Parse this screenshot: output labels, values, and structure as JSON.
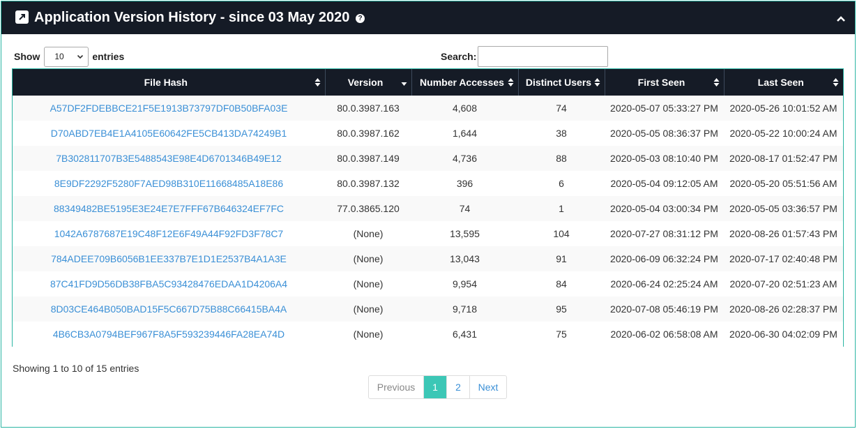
{
  "header": {
    "title": "Application Version History - since 03 May 2020",
    "help": "?"
  },
  "controls": {
    "show_label": "Show",
    "length_value": "10",
    "entries_label": "entries",
    "search_label": "Search:",
    "search_value": ""
  },
  "table": {
    "columns": [
      "File Hash",
      "Version",
      "Number Accesses",
      "Distinct Users",
      "First Seen",
      "Last Seen"
    ],
    "sorted_column": "Version",
    "sort_direction": "desc",
    "rows": [
      [
        "A57DF2FDEBBCE21F5E1913B73797DF0B50BFA03E",
        "80.0.3987.163",
        "4,608",
        "74",
        "2020-05-07 05:33:27 PM",
        "2020-05-26 10:01:52 AM"
      ],
      [
        "D70ABD7EB4E1A4105E60642FE5CB413DA74249B1",
        "80.0.3987.162",
        "1,644",
        "38",
        "2020-05-05 08:36:37 PM",
        "2020-05-22 10:00:24 AM"
      ],
      [
        "7B302811707B3E5488543E98E4D6701346B49E12",
        "80.0.3987.149",
        "4,736",
        "88",
        "2020-05-03 08:10:40 PM",
        "2020-08-17 01:52:47 PM"
      ],
      [
        "8E9DF2292F5280F7AED98B310E11668485A18E86",
        "80.0.3987.132",
        "396",
        "6",
        "2020-05-04 09:12:05 AM",
        "2020-05-20 05:51:56 AM"
      ],
      [
        "88349482BE5195E3E24E7E7FFF67B646324EF7FC",
        "77.0.3865.120",
        "74",
        "1",
        "2020-05-04 03:00:34 PM",
        "2020-05-05 03:36:57 PM"
      ],
      [
        "1042A6787687E19C48F12E6F49A44F92FD3F78C7",
        "(None)",
        "13,595",
        "104",
        "2020-07-27 08:31:12 PM",
        "2020-08-26 01:57:43 PM"
      ],
      [
        "784ADEE709B6056B1EE337B7E1D1E2537B4A1A3E",
        "(None)",
        "13,043",
        "91",
        "2020-06-09 06:32:24 PM",
        "2020-07-17 02:40:48 PM"
      ],
      [
        "87C41FD9D56DB38FBA5C93428476EDAA1D4206A4",
        "(None)",
        "9,954",
        "84",
        "2020-06-24 02:25:24 AM",
        "2020-07-20 02:51:23 AM"
      ],
      [
        "8D03CE464B050BAD15F5C667D75B88C66415BA4A",
        "(None)",
        "9,718",
        "95",
        "2020-07-08 05:46:19 PM",
        "2020-08-26 02:28:37 PM"
      ],
      [
        "4B6CB3A0794BEF967F8A5F593239446FA28EA74D",
        "(None)",
        "6,431",
        "75",
        "2020-06-02 06:58:08 AM",
        "2020-06-30 04:02:09 PM"
      ]
    ]
  },
  "footer": {
    "info": "Showing 1 to 10 of 15 entries",
    "pagination": {
      "previous": "Previous",
      "pages": [
        "1",
        "2"
      ],
      "current": "1",
      "next": "Next"
    }
  },
  "colors": {
    "header_bg": "#151b26",
    "accent": "#2ab5a3",
    "active_page": "#3cc7b6",
    "link": "#3a8fd6"
  }
}
